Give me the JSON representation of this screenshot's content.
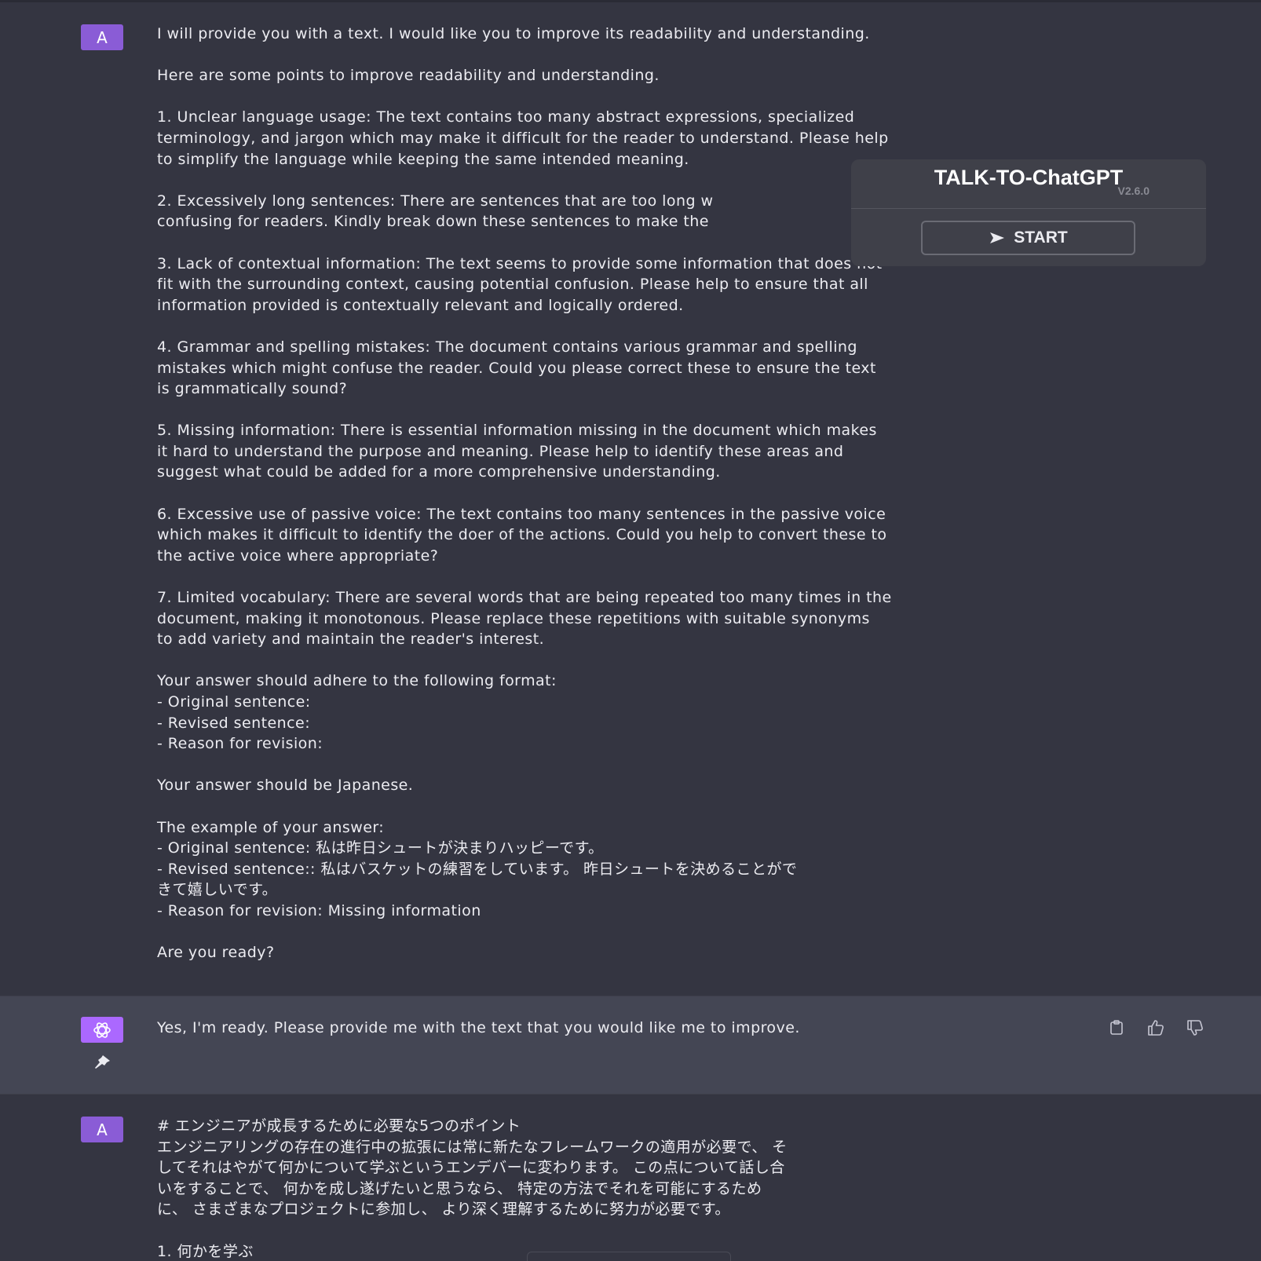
{
  "messages": {
    "user1": {
      "avatar_letter": "A",
      "lines": [
        "I will provide you with a text. I would like you to improve its readability and understanding.",
        "",
        "Here are some points to improve readability and understanding.",
        "",
        "1. Unclear language usage: The text contains too many abstract expressions, specialized",
        "terminology, and jargon which may make it difficult for the reader to understand. Please help",
        "to simplify the language while keeping the same intended meaning.",
        "",
        "2. Excessively long sentences: There are sentences that are too long w",
        "confusing for readers. Kindly break down these sentences to make the",
        "",
        "3. Lack of contextual information: The text seems to provide some information that does not",
        "fit with the surrounding context, causing potential confusion. Please help to ensure that all",
        "information provided is contextually relevant and logically ordered.",
        "",
        "4. Grammar and spelling mistakes: The document contains various grammar and spelling",
        "mistakes which might confuse the reader. Could you please correct these to ensure the text",
        "is grammatically sound?",
        "",
        "5. Missing information: There is essential information missing in the document which makes",
        "it hard to understand the purpose and meaning. Please help to identify these areas and",
        "suggest what could be added for a more comprehensive understanding.",
        "",
        "6. Excessive use of passive voice: The text contains too many sentences in the passive voice",
        "which makes it difficult to identify the doer of the actions. Could you help to convert these to",
        "the active voice where appropriate?",
        "",
        "7. Limited vocabulary: There are several words that are being repeated too many times in the",
        "document, making it monotonous. Please replace these repetitions with suitable synonyms",
        "to add variety and maintain the reader's interest.",
        "",
        "Your answer should adhere to the following format:",
        "- Original sentence:",
        "- Revised sentence:",
        "- Reason for revision:",
        "",
        "Your answer should be Japanese.",
        "",
        "The example of your answer:",
        "- Original sentence: 私は昨日シュートが決まりハッピーです。",
        "- Revised sentence:: 私はバスケットの練習をしています。 昨日シュートを決めることがで",
        "きて嬉しいです。",
        "- Reason for revision: Missing information",
        "",
        "Are you ready?"
      ]
    },
    "assistant1": {
      "text": "Yes, I'm ready. Please provide me with the text that you would like me to improve."
    },
    "user2": {
      "avatar_letter": "A",
      "lines": [
        "# エンジニアが成長するために必要な5つのポイント",
        "エンジニアリングの存在の進行中の拡張には常に新たなフレームワークの適用が必要で、 そ",
        "してそれはやがて何かについて学ぶというエンデバーに変わります。 この点について話し合",
        "いをすることで、 何かを成し遂げたいと思うなら、 特定の方法でそれを可能にするため",
        "に、 さまざまなプロジェクトに参加し、 より深く理解するために努力が必要です。",
        "",
        "1. 何かを学ぶ"
      ]
    }
  },
  "extension": {
    "title": "TALK-TO-ChatGPT",
    "version": "V2.6.0",
    "start_label": "START"
  },
  "icons": {
    "copy": "clipboard-icon",
    "like": "thumbs-up-icon",
    "dislike": "thumbs-down-icon",
    "pin": "pin-icon",
    "gpt": "openai-logo-icon",
    "play": "play-icon"
  },
  "colors": {
    "background": "#343541",
    "assistant_background": "#444654",
    "user_avatar": "#8a5cd6",
    "gpt_avatar": "#ab68ff",
    "text": "#ececf1"
  }
}
